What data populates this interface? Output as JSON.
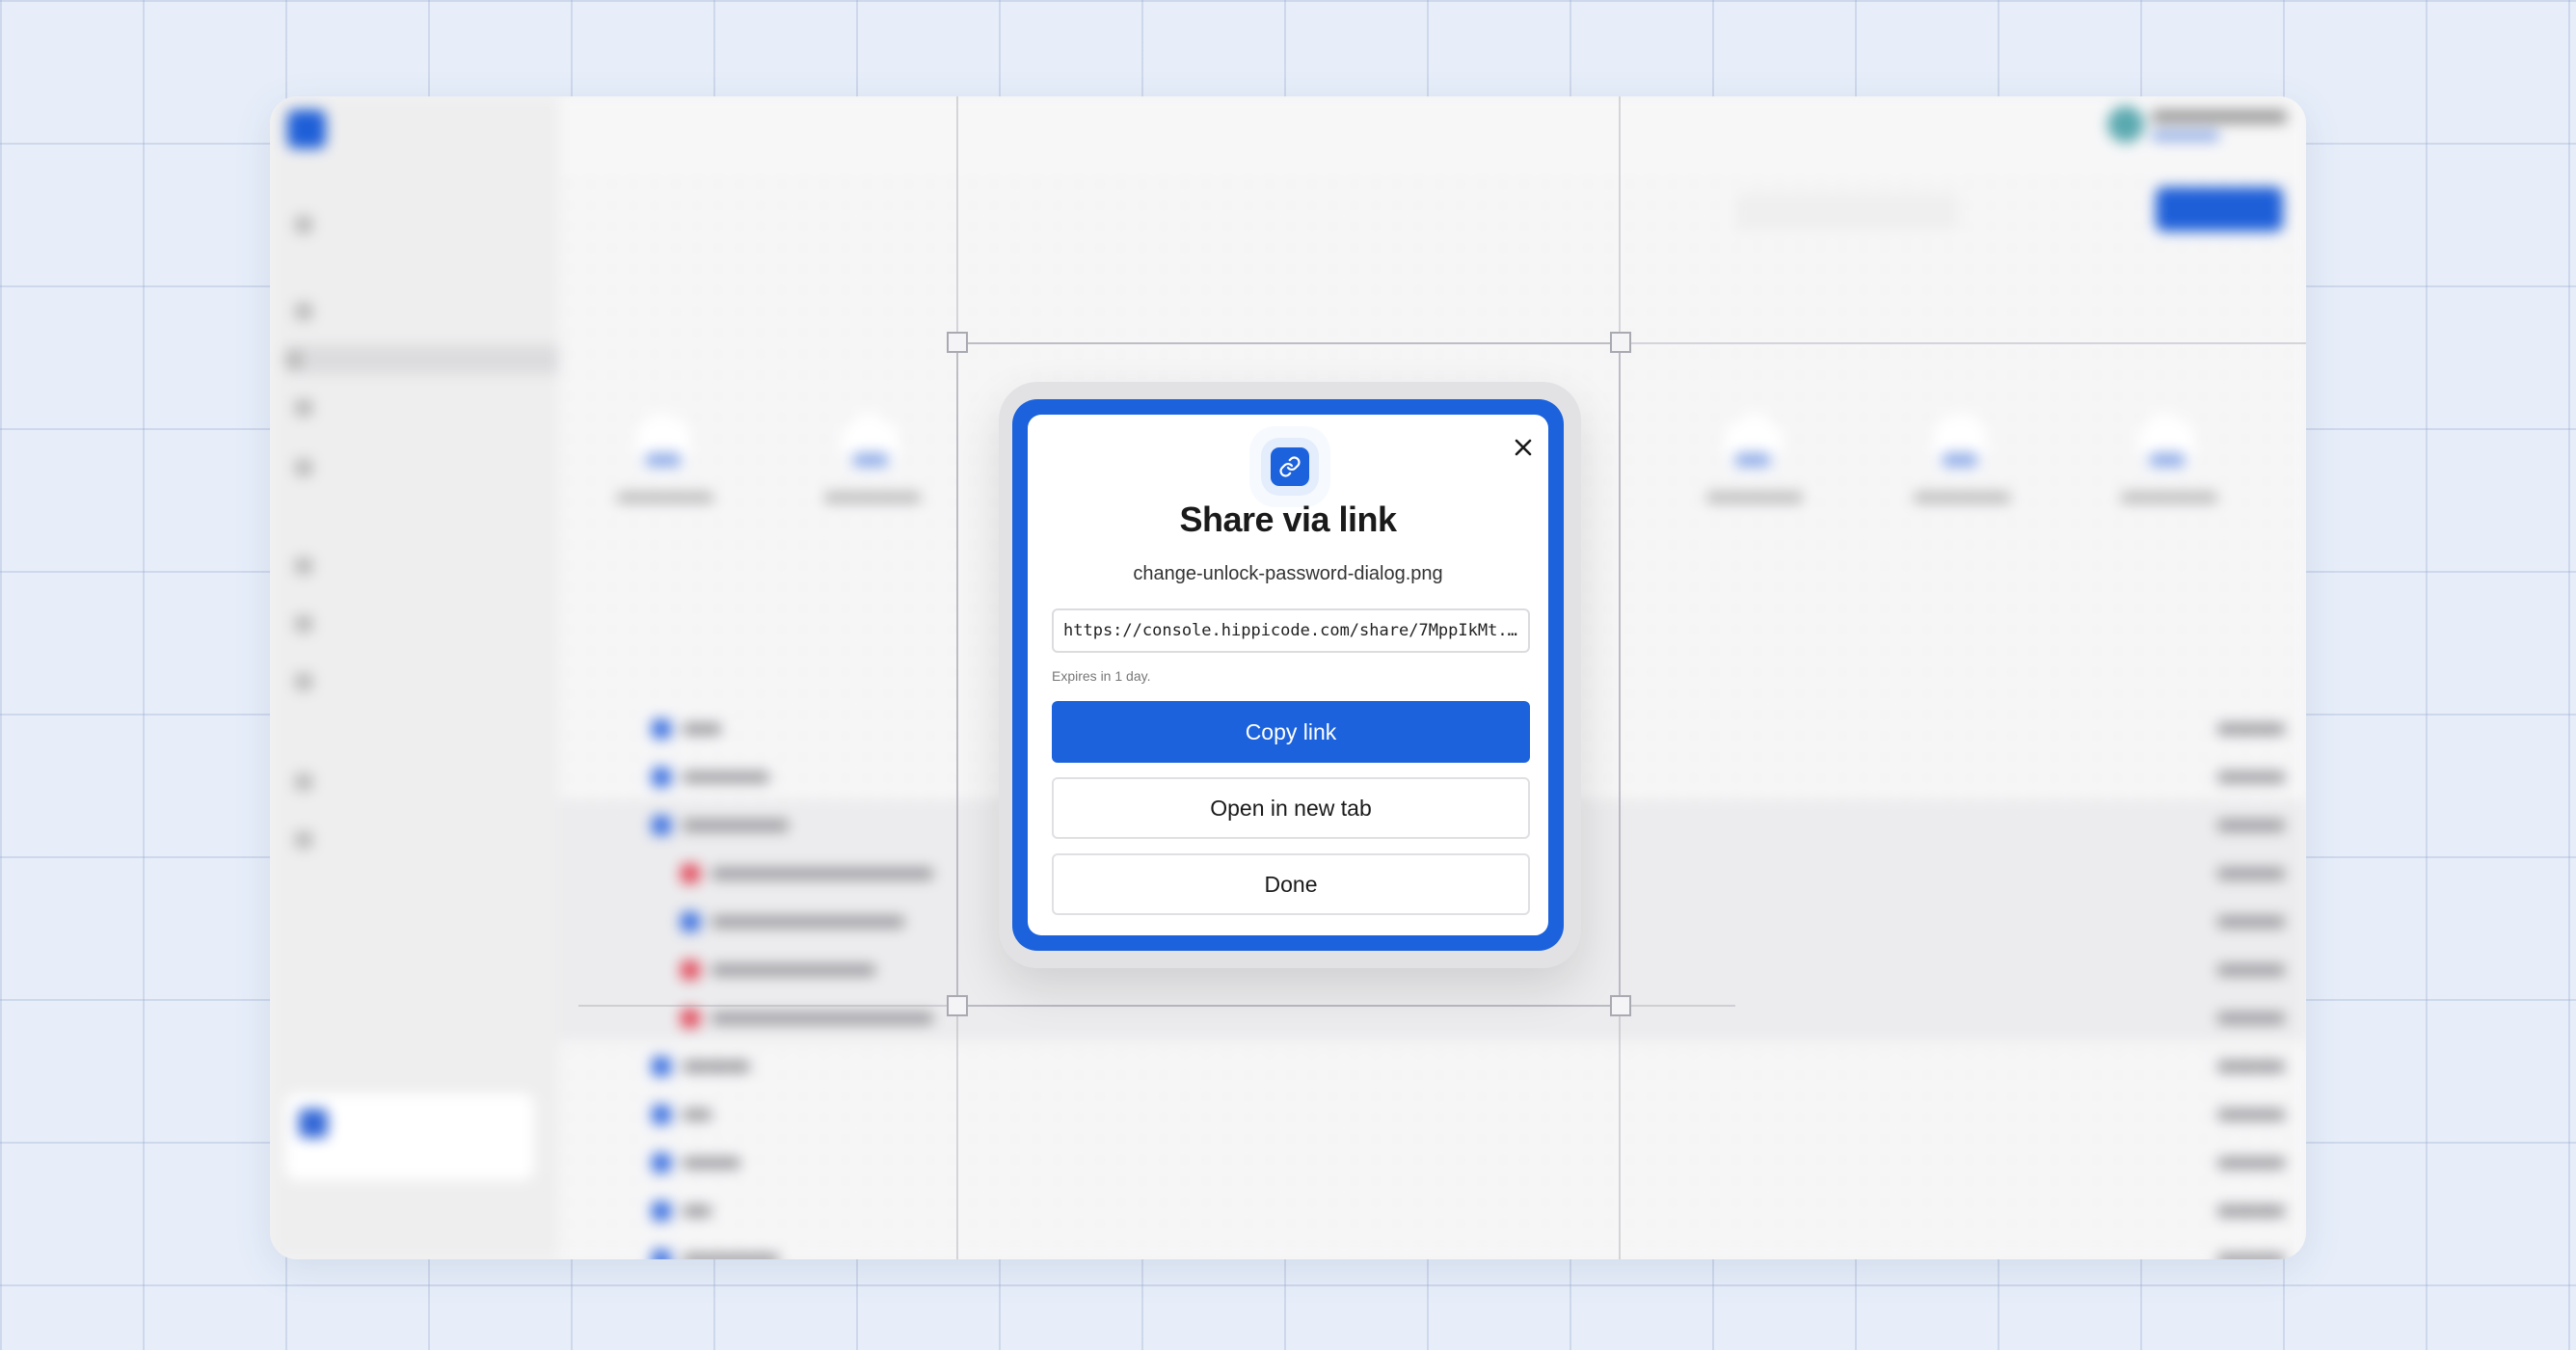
{
  "dialog": {
    "title": "Share via link",
    "file_name": "change-unlock-password-dialog.png",
    "link_value": "https://console.hippicode.com/share/7MppIkMt...",
    "expires_text": "Expires in 1 day.",
    "copy_label": "Copy link",
    "open_label": "Open in new tab",
    "done_label": "Done",
    "icons": {
      "header": "link-icon",
      "close": "close-icon"
    },
    "colors": {
      "accent": "#1b62dc",
      "text": "#1a1a1a"
    }
  }
}
